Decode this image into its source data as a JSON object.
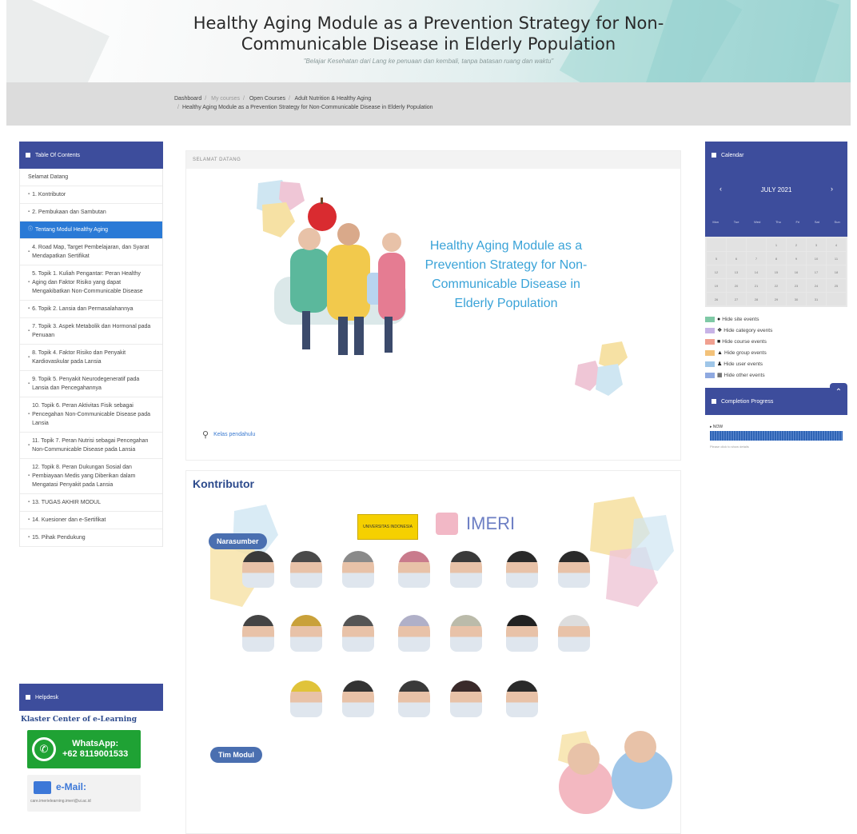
{
  "header": {
    "title_line1": "Healthy Aging Module as a Prevention Strategy for Non-",
    "title_line2": "Communicable Disease in Elderly Population",
    "tagline": "\"Belajar Kesehatan dari Lang ke penuaan dan kembali, tanpa batasan ruang dan waktu\""
  },
  "breadcrumb": {
    "items": [
      "Dashboard",
      "My courses",
      "Open Courses",
      "Adult Nutrition & Healthy Aging"
    ],
    "current": "Healthy Aging Module as a Prevention Strategy for Non-Communicable Disease in Elderly Population"
  },
  "toc": {
    "title": "Table Of Contents",
    "items": [
      "Selamat Datang",
      "1. Kontributor",
      "2. Pembukaan dan Sambutan",
      "Tentang Modul Healthy Aging",
      "4. Road Map, Target Pembelajaran, dan Syarat Mendapatkan Sertifikat",
      "5. Topik 1. Kuliah Pengantar: Peran Healthy Aging dan Faktor Risiko yang dapat Mengakibatkan Non-Communicable Disease",
      "6. Topik 2. Lansia dan Permasalahannya",
      "7. Topik 3. Aspek Metabolik dan Hormonal pada Penuaan",
      "8. Topik 4. Faktor Risiko dan Penyakit Kardiovaskular pada Lansia",
      "9. Topik 5. Penyakit Neurodegeneratif pada Lansia dan Pencegahannya",
      "10. Topik 6. Peran Aktivitas Fisik sebagai Pencegahan Non-Communicable Disease pada Lansia",
      "11. Topik 7. Peran Nutrisi sebagai Pencegahan Non-Communicable Disease pada Lansia",
      "12. Topik 8. Peran Dukungan Sosial dan Pembiayaan Medis yang Diberikan dalam Mengatasi Penyakit pada Lansia",
      "13. TUGAS AKHIR MODUL",
      "14. Kuesioner dan e-Sertifikat",
      "15. Pihak Pendukung"
    ],
    "active_index": 3
  },
  "helpdesk": {
    "title": "Helpdesk",
    "klaster": "Klaster Center of e-Learning",
    "whatsapp_label": "WhatsApp:",
    "whatsapp_number": "+62 8119001533",
    "email_label": "e-Mail:",
    "email_address": "care.imerielearning.imeri@ui.ac.id"
  },
  "main": {
    "section_label": "SELAMAT DATANG",
    "banner_title": "Healthy Aging Module as a Prevention Strategy for Non-Communicable Disease in Elderly Population",
    "search_link": "Kelas pendahulu",
    "kontributor_heading": "Kontributor",
    "narasumber_label": "Narasumber",
    "tim_modul_label": "Tim Modul",
    "logo_ui": "UNIVERSITAS INDONESIA",
    "logo_imeri": "IMERI"
  },
  "calendar": {
    "title": "Calendar",
    "month": "JULY 2021",
    "days": [
      "Mon",
      "Tue",
      "Wed",
      "Thu",
      "Fri",
      "Sat",
      "Sun"
    ],
    "cells": [
      "",
      "",
      "",
      "1",
      "2",
      "3",
      "4",
      "5",
      "6",
      "7",
      "8",
      "9",
      "10",
      "11",
      "12",
      "13",
      "14",
      "15",
      "16",
      "17",
      "18",
      "19",
      "20",
      "21",
      "22",
      "23",
      "24",
      "25",
      "26",
      "27",
      "28",
      "29",
      "30",
      "31",
      ""
    ],
    "events": [
      {
        "label": "Hide site events",
        "color": "#7fc9a6"
      },
      {
        "label": "Hide category events",
        "color": "#c7b3e6"
      },
      {
        "label": "Hide course events",
        "color": "#f0a090"
      },
      {
        "label": "Hide group events",
        "color": "#f3c27a"
      },
      {
        "label": "Hide user events",
        "color": "#9fc6e8"
      },
      {
        "label": "Hide other events",
        "color": "#8fa9e0"
      }
    ]
  },
  "completion": {
    "title": "Completion Progress",
    "label": "NOW",
    "progress": 1.0,
    "note": "Please click to show details"
  },
  "colors": {
    "primary": "#3d4d9c",
    "active": "#2a7ad6",
    "accent_title": "#3aa3d8",
    "whatsapp": "#1fa234"
  }
}
